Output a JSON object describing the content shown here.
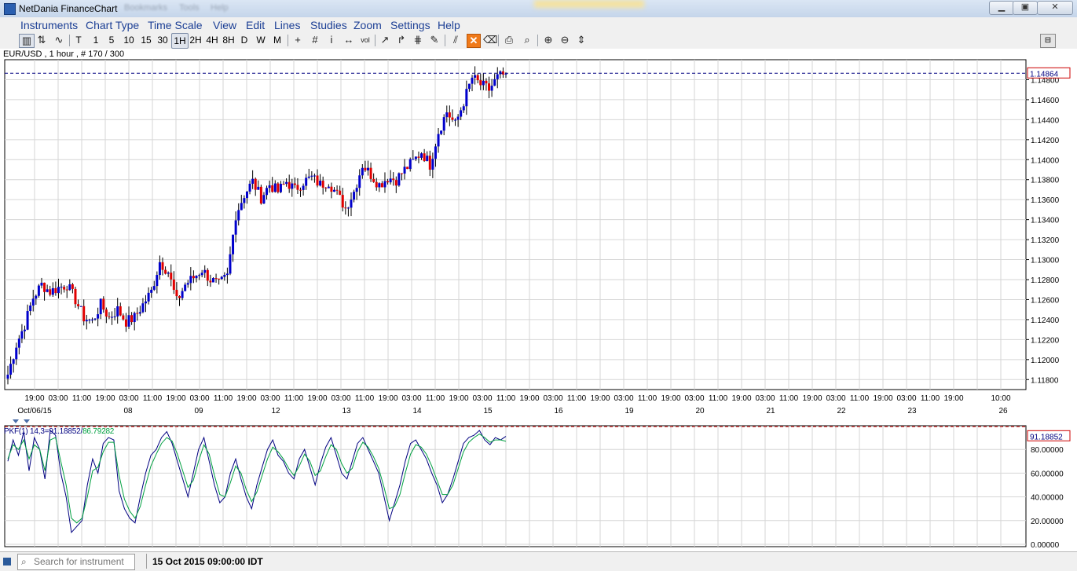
{
  "window": {
    "title": "NetDania FinanceChart",
    "blurred_tabs": [
      "Bookmarks",
      "Tools",
      "Help"
    ],
    "minimize": "▁",
    "maximize": "▣",
    "close": "✕"
  },
  "menu": [
    "Instruments",
    "Chart Type",
    "Time Scale",
    "View",
    "Edit",
    "Lines",
    "Studies",
    "Zoom",
    "Settings",
    "Help"
  ],
  "toolbar": {
    "chart_types": [
      {
        "name": "bar-chart-icon",
        "glyph": "▥",
        "active": true
      },
      {
        "name": "ohlc-icon",
        "glyph": "⇅",
        "active": false
      },
      {
        "name": "line-chart-icon",
        "glyph": "∿",
        "active": false
      }
    ],
    "timescales": [
      {
        "label": "T",
        "active": false
      },
      {
        "label": "1",
        "active": false
      },
      {
        "label": "5",
        "active": false
      },
      {
        "label": "10",
        "active": false
      },
      {
        "label": "15",
        "active": false
      },
      {
        "label": "30",
        "active": false
      },
      {
        "label": "1H",
        "active": true
      },
      {
        "label": "2H",
        "active": false
      },
      {
        "label": "4H",
        "active": false
      },
      {
        "label": "8H",
        "active": false
      },
      {
        "label": "D",
        "active": false
      },
      {
        "label": "W",
        "active": false
      },
      {
        "label": "M",
        "active": false
      }
    ],
    "tools": [
      {
        "name": "crosshair-icon",
        "glyph": "+"
      },
      {
        "name": "grid-icon",
        "glyph": "#"
      },
      {
        "name": "info-icon",
        "glyph": "i"
      },
      {
        "name": "horizontal-arrows-icon",
        "glyph": "↔"
      },
      {
        "name": "volume-icon",
        "glyph": "vol"
      },
      {
        "name": "trendline-icon",
        "glyph": "↗"
      },
      {
        "name": "ray-icon",
        "glyph": "↱"
      },
      {
        "name": "fibonacci-icon",
        "glyph": "⋕"
      },
      {
        "name": "pencil-icon",
        "glyph": "✎"
      },
      {
        "name": "channel-icon",
        "glyph": "⫽"
      },
      {
        "name": "delete-icon",
        "glyph": "✕"
      },
      {
        "name": "delete-all-icon",
        "glyph": "⌫"
      },
      {
        "name": "print-icon",
        "glyph": "⎙"
      },
      {
        "name": "preview-icon",
        "glyph": "⌕"
      },
      {
        "name": "zoom-in-icon",
        "glyph": "⊕"
      },
      {
        "name": "zoom-out-icon",
        "glyph": "⊖"
      },
      {
        "name": "zoom-fit-icon",
        "glyph": "⇕"
      }
    ],
    "side_toggle": "⊟"
  },
  "chart": {
    "instrument_label": "EUR/USD , 1 hour , # 170 / 300",
    "indicator_label_prefix": "PKF(1) 14,3=",
    "indicator_k": "91.18852",
    "indicator_sep": "/",
    "indicator_d": "86.79282",
    "colors": {
      "up": "#0000cc",
      "down": "#e00000",
      "grid": "#d6d6d6",
      "line_k": "#000080",
      "line_d": "#00a040"
    }
  },
  "chart_data": [
    {
      "type": "candlestick",
      "title": "EUR/USD , 1 hour , # 170 / 300",
      "ylim": [
        1.117,
        1.15
      ],
      "y_ticks": [
        "1.11800",
        "1.12000",
        "1.12200",
        "1.12400",
        "1.12600",
        "1.12800",
        "1.13000",
        "1.13200",
        "1.13400",
        "1.13600",
        "1.13800",
        "1.14000",
        "1.14200",
        "1.14400",
        "1.14600",
        "1.14800"
      ],
      "last_price": "1.14864",
      "last_value": 1.14864,
      "x_time_labels": [
        "19:00",
        "03:00",
        "11:00",
        "19:00",
        "03:00",
        "11:00",
        "19:00",
        "03:00",
        "11:00",
        "19:00",
        "03:00",
        "11:00",
        "19:00",
        "03:00",
        "11:00",
        "19:00",
        "03:00",
        "11:00",
        "19:00",
        "03:00",
        "11:00",
        "19:00",
        "03:00",
        "11:00",
        "19:00",
        "03:00",
        "11:00",
        "19:00",
        "03:00",
        "11:00",
        "19:00",
        "03:00",
        "11:00",
        "19:00",
        "03:00",
        "11:00",
        "19:00",
        "03:00",
        "11:00",
        "19:00",
        "10:00"
      ],
      "x_date_labels": [
        "Oct/06/15",
        "08",
        "09",
        "12",
        "13",
        "14",
        "15",
        "16",
        "19",
        "20",
        "21",
        "22",
        "23",
        "26"
      ],
      "close_path": [
        1.1185,
        1.1215,
        1.1235,
        1.1262,
        1.1275,
        1.1268,
        1.1272,
        1.1275,
        1.126,
        1.1242,
        1.1238,
        1.1255,
        1.1242,
        1.125,
        1.1238,
        1.1242,
        1.1255,
        1.1268,
        1.1298,
        1.1288,
        1.1258,
        1.1275,
        1.1282,
        1.129,
        1.128,
        1.1275,
        1.1283,
        1.1345,
        1.1365,
        1.1378,
        1.1362,
        1.1375,
        1.1368,
        1.1378,
        1.137,
        1.1378,
        1.1382,
        1.1375,
        1.1378,
        1.1365,
        1.1352,
        1.1368,
        1.1395,
        1.1385,
        1.1375,
        1.1382,
        1.138,
        1.139,
        1.1398,
        1.1408,
        1.1395,
        1.1428,
        1.1448,
        1.1435,
        1.1458,
        1.1482,
        1.1475,
        1.147,
        1.1482,
        1.1486
      ]
    },
    {
      "type": "line",
      "title": "PKF(1) 14,3",
      "ylim": [
        -2,
        100
      ],
      "y_ticks": [
        "0.00000",
        "20.00000",
        "40.00000",
        "60.00000",
        "80.00000"
      ],
      "last_price": "91.18852",
      "last_value": 91.18852,
      "series": [
        {
          "name": "K",
          "values": [
            70,
            88,
            75,
            95,
            62,
            90,
            80,
            55,
            96,
            92,
            60,
            40,
            10,
            15,
            20,
            50,
            72,
            60,
            85,
            90,
            88,
            45,
            30,
            22,
            18,
            40,
            60,
            75,
            80,
            90,
            95,
            85,
            70,
            55,
            40,
            60,
            80,
            90,
            70,
            50,
            35,
            40,
            60,
            72,
            55,
            40,
            30,
            50,
            65,
            80,
            88,
            75,
            70,
            60,
            55,
            72,
            80,
            65,
            50,
            68,
            82,
            90,
            75,
            60,
            55,
            70,
            85,
            90,
            80,
            70,
            60,
            40,
            20,
            35,
            50,
            70,
            85,
            88,
            80,
            72,
            60,
            50,
            35,
            42,
            55,
            70,
            85,
            90,
            92,
            96,
            88,
            84,
            90,
            88,
            91
          ]
        },
        {
          "name": "D",
          "values": [
            72,
            84,
            80,
            88,
            72,
            84,
            80,
            62,
            88,
            90,
            70,
            50,
            22,
            18,
            22,
            40,
            62,
            65,
            78,
            86,
            86,
            58,
            38,
            28,
            22,
            32,
            50,
            66,
            76,
            85,
            90,
            87,
            76,
            62,
            48,
            54,
            70,
            84,
            76,
            58,
            42,
            40,
            52,
            66,
            60,
            46,
            36,
            44,
            58,
            72,
            82,
            78,
            72,
            64,
            58,
            66,
            76,
            70,
            58,
            62,
            74,
            84,
            80,
            68,
            60,
            64,
            78,
            86,
            82,
            74,
            64,
            48,
            30,
            32,
            42,
            60,
            76,
            84,
            82,
            76,
            66,
            54,
            42,
            42,
            50,
            64,
            78,
            86,
            90,
            93,
            90,
            86,
            88,
            88,
            86.8
          ]
        }
      ]
    }
  ]
}
